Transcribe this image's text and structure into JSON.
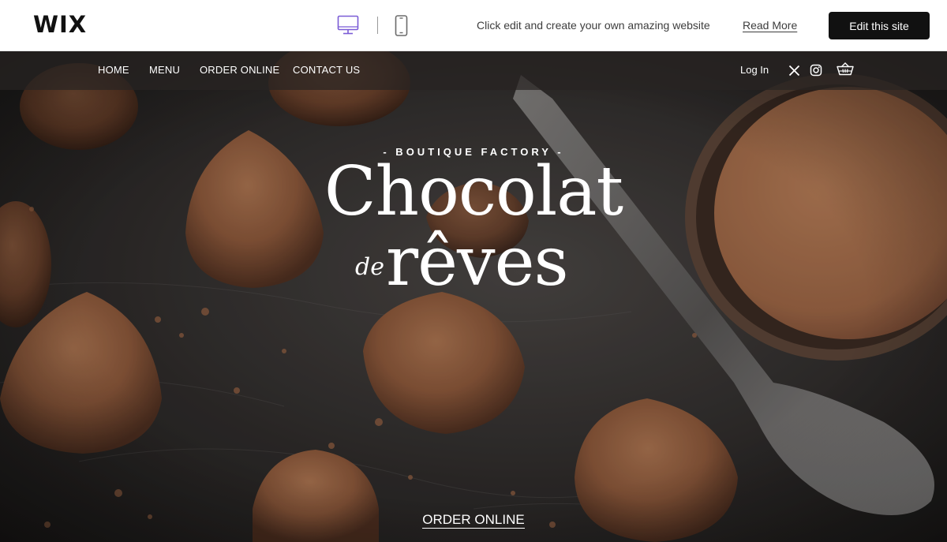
{
  "wix_bar": {
    "logo": "WIX",
    "promo_text": "Click edit and create your own amazing website",
    "read_more": "Read More",
    "edit_button": "Edit this site"
  },
  "site": {
    "nav": {
      "items": [
        {
          "label": "HOME"
        },
        {
          "label": "MENU"
        },
        {
          "label": "ORDER ONLINE"
        },
        {
          "label": "CONTACT US"
        }
      ],
      "login": "Log In"
    },
    "hero": {
      "eyebrow": "- BOUTIQUE FACTORY -",
      "title": "Chocolat",
      "title_connector": "de",
      "title_sub": "rêves",
      "cta": "ORDER ONLINE"
    },
    "colors": {
      "text": "#ffffff",
      "nav_bg": "#2c2826",
      "button_bg": "#111111",
      "cocoa": "#8a5a3c"
    },
    "icons": [
      "desktop-icon",
      "mobile-icon",
      "x-icon",
      "instagram-icon",
      "cart-icon"
    ]
  }
}
